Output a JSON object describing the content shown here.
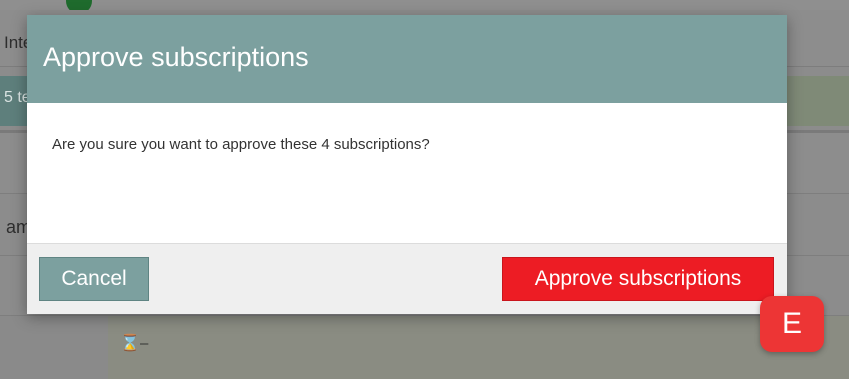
{
  "background": {
    "row1_text": "Inte",
    "row2_text": "5 te",
    "row4_text": "am",
    "status_icon": "hourglass-icon",
    "status_dash": "–"
  },
  "dialog": {
    "title": "Approve subscriptions",
    "message": "Are you sure you want to approve these 4 subscriptions?",
    "cancel_label": "Cancel",
    "confirm_label": "Approve subscriptions"
  },
  "hint_badge": {
    "label": "E"
  },
  "colors": {
    "header": "#7ca09f",
    "confirm": "#ed1c24",
    "badge": "#ed3535",
    "footer": "#efefef"
  }
}
